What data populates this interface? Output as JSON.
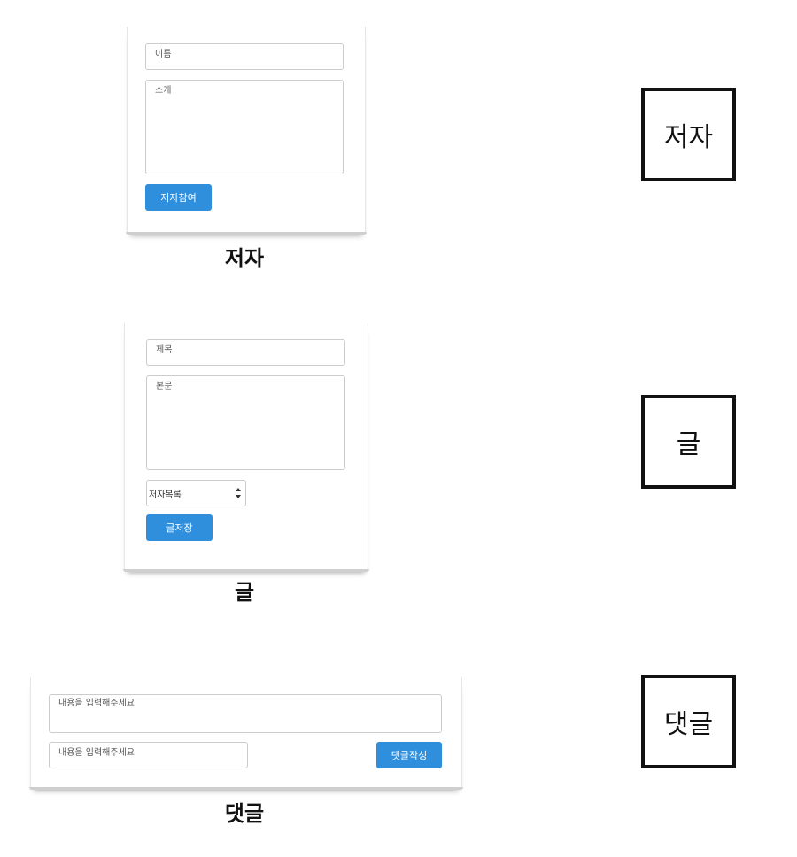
{
  "author": {
    "name_placeholder": "이름",
    "intro_placeholder": "소개",
    "submit_label": "저자참여",
    "caption": "저자",
    "box_label": "저자"
  },
  "post": {
    "title_placeholder": "제목",
    "body_placeholder": "본문",
    "author_select_value": "저자목록",
    "submit_label": "글저장",
    "caption": "글",
    "box_label": "글"
  },
  "comment": {
    "content_placeholder": "내용을 입력해주세요",
    "name_placeholder": "내용을 입력해주세요",
    "submit_label": "댓글작성",
    "caption": "댓글",
    "box_label": "댓글"
  },
  "colors": {
    "button": "#2f8fdd",
    "box_border": "#111111"
  }
}
